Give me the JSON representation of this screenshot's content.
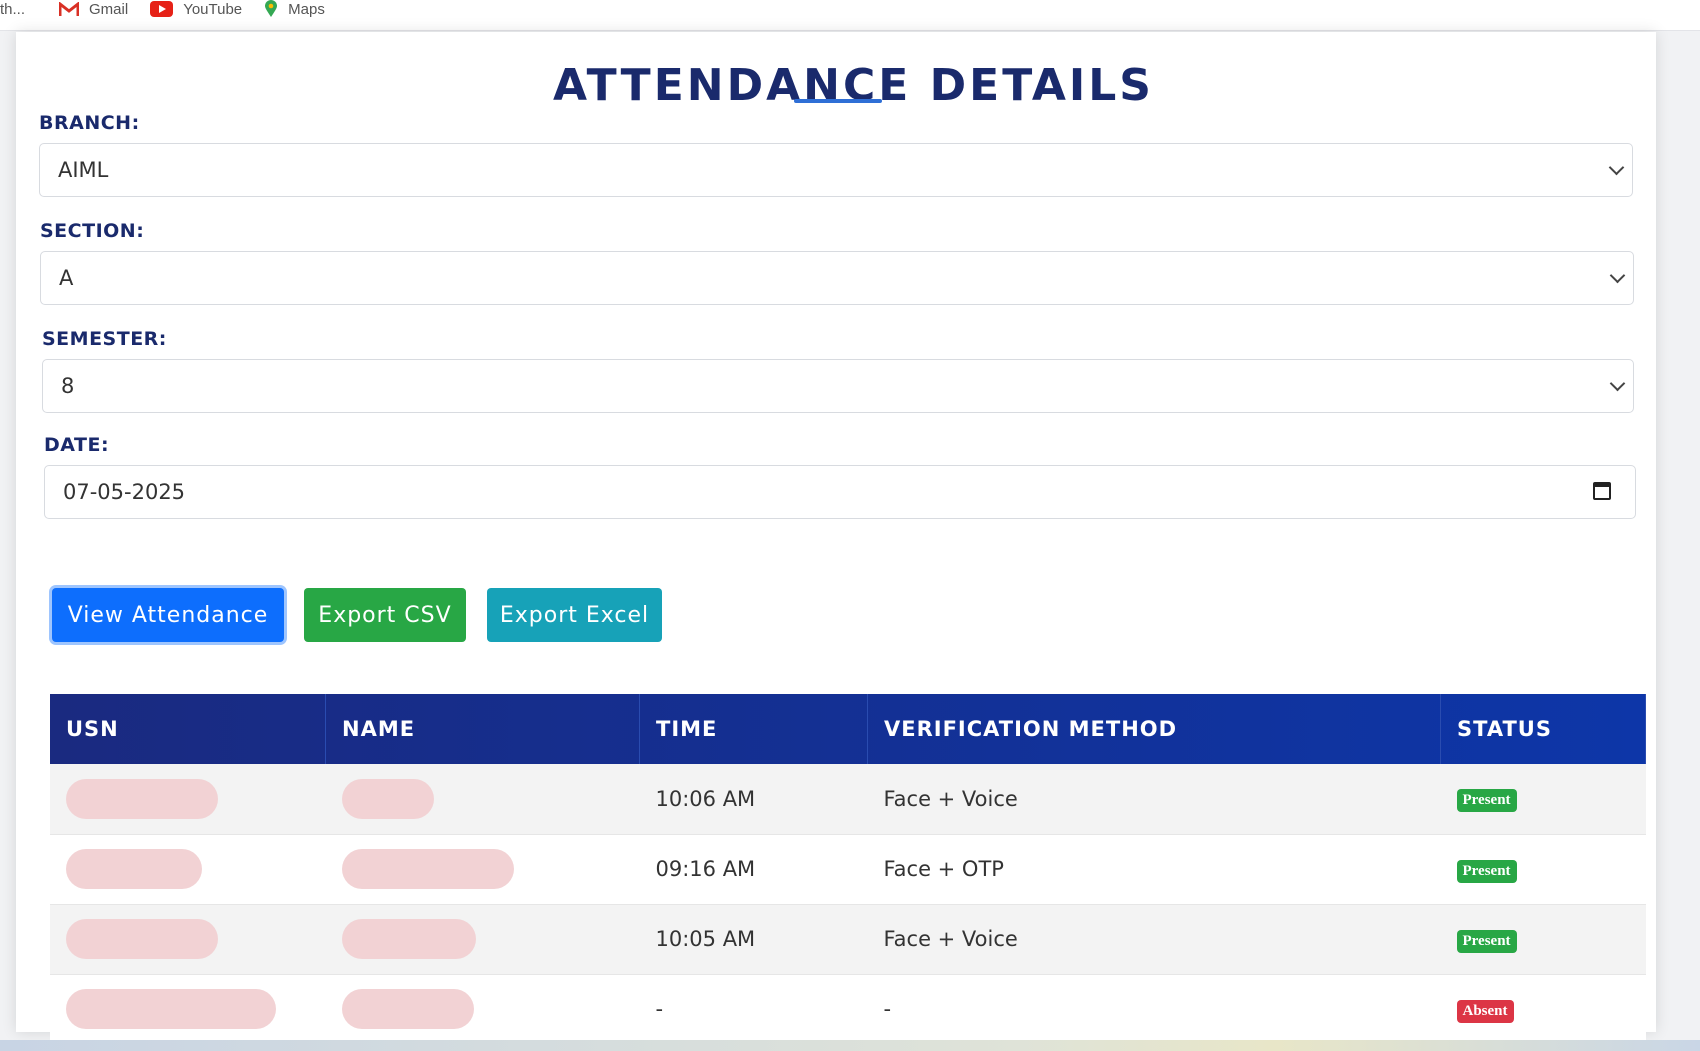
{
  "bookmarks": [
    {
      "label": "th...",
      "icon": "truncated-bookmark"
    },
    {
      "label": "Gmail",
      "icon": "gmail-icon"
    },
    {
      "label": "YouTube",
      "icon": "youtube-icon"
    },
    {
      "label": "Maps",
      "icon": "maps-icon"
    }
  ],
  "page": {
    "title": "ATTENDANCE DETAILS"
  },
  "form": {
    "branch": {
      "label": "BRANCH:",
      "value": "AIML"
    },
    "section": {
      "label": "SECTION:",
      "value": "A"
    },
    "semester": {
      "label": "SEMESTER:",
      "value": "8"
    },
    "date": {
      "label": "DATE:",
      "value": "07-05-2025"
    }
  },
  "buttons": {
    "view": "View Attendance",
    "csv": "Export CSV",
    "excel": "Export Excel"
  },
  "table": {
    "headers": [
      "USN",
      "NAME",
      "TIME",
      "VERIFICATION METHOD",
      "STATUS"
    ],
    "rows": [
      {
        "time": "10:06 AM",
        "method": "Face + Voice",
        "status": "Present"
      },
      {
        "time": "09:16 AM",
        "method": "Face + OTP",
        "status": "Present"
      },
      {
        "time": "10:05 AM",
        "method": "Face + Voice",
        "status": "Present"
      },
      {
        "time": "-",
        "method": "-",
        "status": "Absent"
      }
    ]
  },
  "colors": {
    "title": "#1a2a6c",
    "present": "#28a745",
    "absent": "#dc3545",
    "view_button": "#0d6efd",
    "csv_button": "#28a745",
    "excel_button": "#17a2b8",
    "header_bg": "#1a2a80"
  }
}
